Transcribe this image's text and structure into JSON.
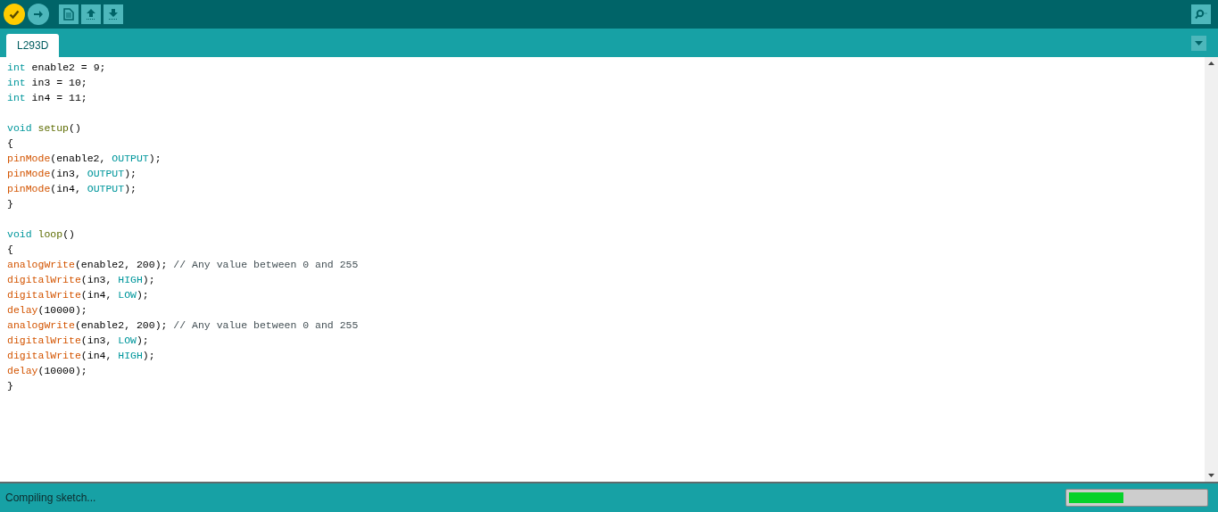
{
  "toolbar": {
    "buttons": [
      {
        "kind": "verify",
        "active": true
      },
      {
        "kind": "upload",
        "active": false
      },
      {
        "kind": "new",
        "active": false
      },
      {
        "kind": "open",
        "active": false
      },
      {
        "kind": "save",
        "active": false
      }
    ]
  },
  "tabs": [
    {
      "label": "L293D",
      "selected": true
    }
  ],
  "code": [
    {
      "tokens": [
        {
          "kind": "type",
          "text": "int"
        },
        {
          "kind": "plain",
          "text": " enable2 = 9;"
        }
      ]
    },
    {
      "tokens": [
        {
          "kind": "type",
          "text": "int"
        },
        {
          "kind": "plain",
          "text": " in3 = 10;"
        }
      ]
    },
    {
      "tokens": [
        {
          "kind": "type",
          "text": "int"
        },
        {
          "kind": "plain",
          "text": " in4 = 11;"
        }
      ]
    },
    {
      "kind": "blank"
    },
    {
      "tokens": [
        {
          "kind": "type",
          "text": "void"
        },
        {
          "kind": "name",
          "text": " setup"
        },
        {
          "kind": "plain",
          "text": "()"
        }
      ]
    },
    {
      "tokens": [
        {
          "kind": "plain",
          "text": "{"
        }
      ]
    },
    {
      "tokens": [
        {
          "kind": "func",
          "text": "pinMode"
        },
        {
          "kind": "plain",
          "text": "(enable2, "
        },
        {
          "kind": "const",
          "text": "OUTPUT"
        },
        {
          "kind": "plain",
          "text": ");"
        }
      ]
    },
    {
      "tokens": [
        {
          "kind": "func",
          "text": "pinMode"
        },
        {
          "kind": "plain",
          "text": "(in3, "
        },
        {
          "kind": "const",
          "text": "OUTPUT"
        },
        {
          "kind": "plain",
          "text": ");"
        }
      ]
    },
    {
      "tokens": [
        {
          "kind": "func",
          "text": "pinMode"
        },
        {
          "kind": "plain",
          "text": "(in4, "
        },
        {
          "kind": "const",
          "text": "OUTPUT"
        },
        {
          "kind": "plain",
          "text": ");"
        }
      ]
    },
    {
      "tokens": [
        {
          "kind": "plain",
          "text": "}"
        }
      ]
    },
    {
      "kind": "blank"
    },
    {
      "tokens": [
        {
          "kind": "type",
          "text": "void"
        },
        {
          "kind": "name",
          "text": " loop"
        },
        {
          "kind": "plain",
          "text": "()"
        }
      ]
    },
    {
      "tokens": [
        {
          "kind": "plain",
          "text": "{"
        }
      ]
    },
    {
      "tokens": [
        {
          "kind": "func",
          "text": "analogWrite"
        },
        {
          "kind": "plain",
          "text": "(enable2, 200); "
        },
        {
          "kind": "comment",
          "text": "// Any value between 0 and 255"
        }
      ]
    },
    {
      "tokens": [
        {
          "kind": "func",
          "text": "digitalWrite"
        },
        {
          "kind": "plain",
          "text": "(in3, "
        },
        {
          "kind": "const",
          "text": "HIGH"
        },
        {
          "kind": "plain",
          "text": ");"
        }
      ]
    },
    {
      "tokens": [
        {
          "kind": "func",
          "text": "digitalWrite"
        },
        {
          "kind": "plain",
          "text": "(in4, "
        },
        {
          "kind": "const",
          "text": "LOW"
        },
        {
          "kind": "plain",
          "text": ");"
        }
      ]
    },
    {
      "tokens": [
        {
          "kind": "func",
          "text": "delay"
        },
        {
          "kind": "plain",
          "text": "(10000);"
        }
      ]
    },
    {
      "tokens": [
        {
          "kind": "func",
          "text": "analogWrite"
        },
        {
          "kind": "plain",
          "text": "(enable2, 200); "
        },
        {
          "kind": "comment",
          "text": "// Any value between 0 and 255"
        }
      ]
    },
    {
      "tokens": [
        {
          "kind": "func",
          "text": "digitalWrite"
        },
        {
          "kind": "plain",
          "text": "(in3, "
        },
        {
          "kind": "const",
          "text": "LOW"
        },
        {
          "kind": "plain",
          "text": ");"
        }
      ]
    },
    {
      "tokens": [
        {
          "kind": "func",
          "text": "digitalWrite"
        },
        {
          "kind": "plain",
          "text": "(in4, "
        },
        {
          "kind": "const",
          "text": "HIGH"
        },
        {
          "kind": "plain",
          "text": ");"
        }
      ]
    },
    {
      "tokens": [
        {
          "kind": "func",
          "text": "delay"
        },
        {
          "kind": "plain",
          "text": "(10000);"
        }
      ]
    },
    {
      "tokens": [
        {
          "kind": "plain",
          "text": "}"
        }
      ]
    }
  ],
  "status_bar": {
    "message": "Compiling sketch...",
    "progress": {
      "level": 0.4
    }
  }
}
